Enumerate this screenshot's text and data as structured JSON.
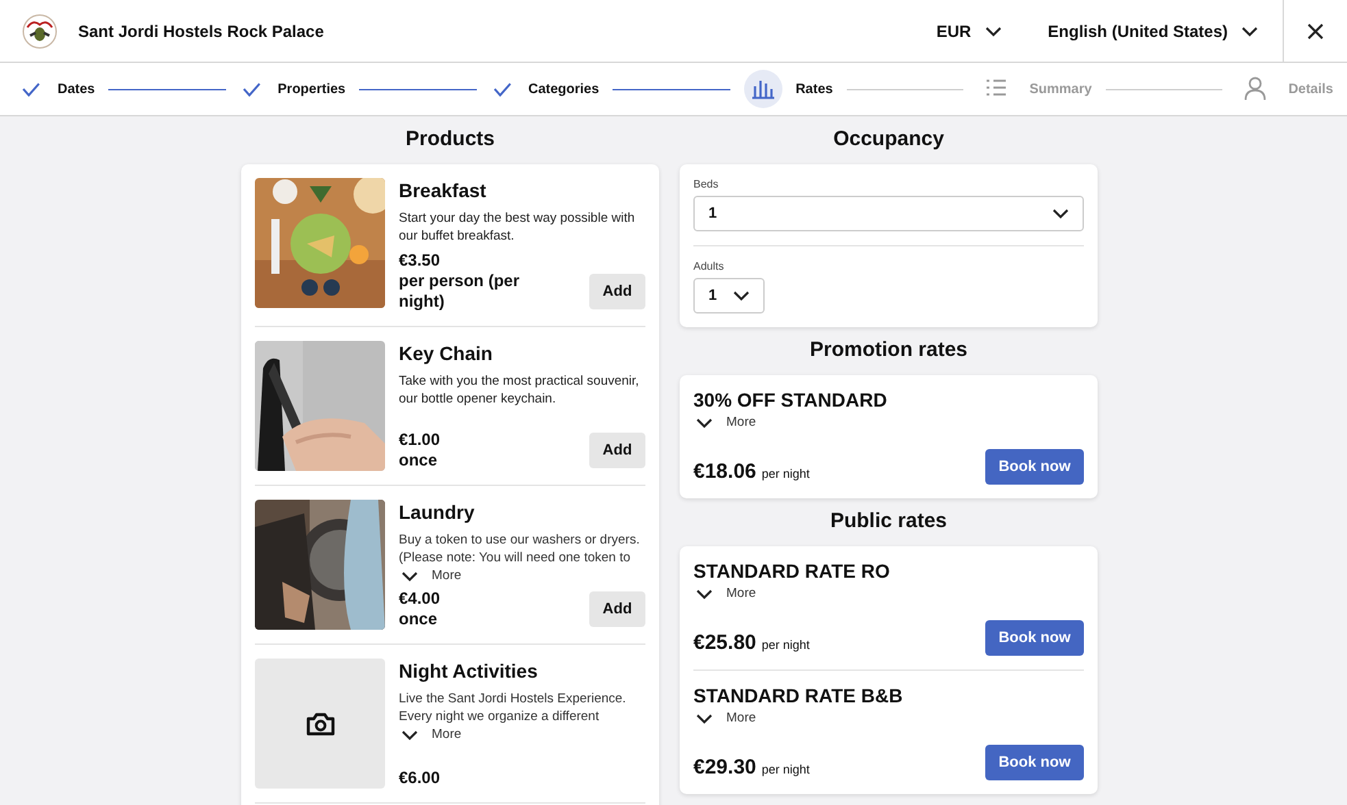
{
  "header": {
    "hotel_name": "Sant Jordi Hostels Rock Palace",
    "currency": "EUR",
    "language": "English (United States)"
  },
  "steps": [
    {
      "label": "Dates",
      "done": true,
      "selected": false
    },
    {
      "label": "Properties",
      "done": true,
      "selected": false
    },
    {
      "label": "Categories",
      "done": true,
      "selected": false
    },
    {
      "label": "Rates",
      "done": false,
      "selected": true
    },
    {
      "label": "Summary",
      "done": false,
      "selected": false
    },
    {
      "label": "Details",
      "done": false,
      "selected": false
    }
  ],
  "products": {
    "title": "Products",
    "items": [
      {
        "name": "Breakfast",
        "kind": "picture",
        "description": "Start your day the best way possible with our buffet breakfast.",
        "price": "€3.50",
        "unit": "per person (per night)",
        "button": "Add"
      },
      {
        "name": "Key Chain",
        "kind": "picture",
        "description": "Take with you the most practical souvenir, our bottle opener keychain.",
        "price": "€1.00",
        "unit": "once",
        "button": "Add"
      },
      {
        "name": "Laundry",
        "kind": "picture",
        "description": "Buy a token to use our washers or dryers. (Please note: You will need one token to",
        "more": "More",
        "price": "€4.00",
        "unit": "once",
        "button": "Add"
      },
      {
        "name": "Night Activities",
        "kind": "placeholder",
        "description": "Live the Sant Jordi Hostels Experience. Every night we organize a different",
        "more": "More",
        "price": "€6.00"
      }
    ]
  },
  "occupancy": {
    "title": "Occupancy",
    "fields": [
      {
        "label": "Beds",
        "value": "1",
        "wide": true
      },
      {
        "label": "Adults",
        "value": "1",
        "wide": false
      }
    ]
  },
  "rate_groups": [
    {
      "title": "Promotion rates",
      "rates": [
        {
          "name": "30% OFF STANDARD",
          "more": "More",
          "price": "€18.06",
          "unit": "per night",
          "button": "Book now"
        }
      ]
    },
    {
      "title": "Public rates",
      "rates": [
        {
          "name": "STANDARD RATE RO",
          "more": "More",
          "price": "€25.80",
          "unit": "per night",
          "button": "Book now"
        },
        {
          "name": "STANDARD RATE B&B",
          "more": "More",
          "price": "€29.30",
          "unit": "per night",
          "button": "Book now"
        }
      ]
    }
  ]
}
